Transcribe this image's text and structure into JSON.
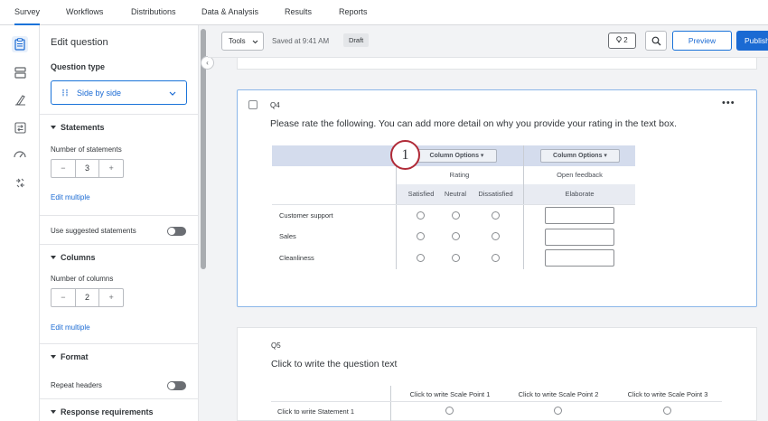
{
  "topnav": {
    "tabs": [
      "Survey",
      "Workflows",
      "Distributions",
      "Data & Analysis",
      "Results",
      "Reports"
    ],
    "active": "Survey"
  },
  "rail": {
    "icons": [
      "survey-icon",
      "layout-icon",
      "look-and-feel-icon",
      "survey-flow-icon",
      "options-icon",
      "tools-icon"
    ]
  },
  "sidebar": {
    "title": "Edit question",
    "question_type_label": "Question type",
    "question_type_value": "Side by side",
    "statements": {
      "heading": "Statements",
      "count_label": "Number of statements",
      "count": "3",
      "edit_multiple": "Edit multiple",
      "use_suggested": "Use suggested statements"
    },
    "columns": {
      "heading": "Columns",
      "count_label": "Number of columns",
      "count": "2",
      "edit_multiple": "Edit multiple"
    },
    "format": {
      "heading": "Format",
      "repeat_headers": "Repeat headers"
    },
    "response_requirements": "Response requirements",
    "stepper_minus": "−",
    "stepper_plus": "+",
    "collapse_glyph": "‹"
  },
  "toolbar": {
    "tools": "Tools",
    "saved": "Saved at 9:41 AM",
    "status": "Draft",
    "notifications": "2",
    "preview": "Preview",
    "publish": "Publish"
  },
  "q4": {
    "id": "Q4",
    "text": "Please rate the following. You can add more detail on why you provide your rating in the text box.",
    "more": "•••",
    "column_options_label": "Column Options",
    "groups": [
      {
        "header": "Rating",
        "choices": [
          "Satisfied",
          "Neutral",
          "Dissatisfied"
        ]
      },
      {
        "header": "Open feedback",
        "choices": [
          "Elaborate"
        ]
      }
    ],
    "statements": [
      "Customer support",
      "Sales",
      "Cleanliness"
    ]
  },
  "callout": {
    "number": "1"
  },
  "q5": {
    "id": "Q5",
    "text": "Click to write the question text",
    "scale_points": [
      "Click to write Scale Point 1",
      "Click to write Scale Point 2",
      "Click to write Scale Point 3"
    ],
    "statements": [
      "Click to write Statement 1"
    ]
  }
}
